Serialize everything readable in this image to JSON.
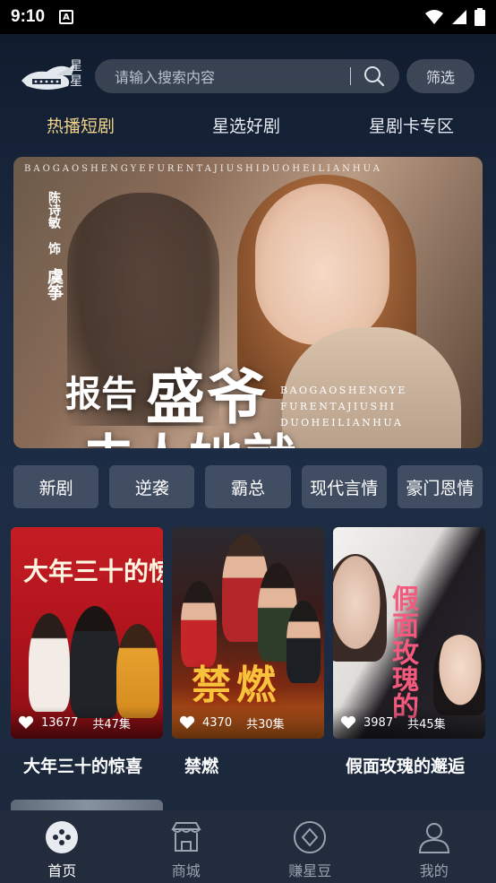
{
  "status_bar": {
    "time": "9:10",
    "notif_icon": "A"
  },
  "header": {
    "logo_text_line1": "星",
    "logo_text_line2": "星",
    "logo_sub": "THEATE",
    "search_placeholder": "请输入搜索内容",
    "filter_label": "筛选"
  },
  "tabs": [
    {
      "label": "热播短剧",
      "active": true
    },
    {
      "label": "星选好剧",
      "active": false
    },
    {
      "label": "星剧卡专区",
      "active": false
    }
  ],
  "banner": {
    "letters_top": "BAOGAOSHENGYEFURENTAJIUSHIDUOHEILIANHUA",
    "cast_name": "陈诗敏",
    "cast_as": "饰",
    "role_name": "虞筝",
    "title_small": "报告",
    "title_big": "盛爷",
    "title_bottom": "夫人她就",
    "subtitle_lines": [
      "BAOGAOSHENGYE",
      "FURENTAJIUSHI",
      "DUOHEILIANHUA"
    ]
  },
  "categories": [
    "新剧",
    "逆袭",
    "霸总",
    "现代言情",
    "豪门恩情"
  ],
  "dramas": [
    {
      "title": "大年三十的惊喜",
      "poster_text": "大年三十的惊喜",
      "likes": "13677",
      "episodes": "共47集"
    },
    {
      "title": "禁燃",
      "poster_text": "禁燃",
      "likes": "4370",
      "episodes": "共30集"
    },
    {
      "title": "假面玫瑰的邂逅",
      "poster_text": "假面玫瑰的",
      "likes": "3987",
      "episodes": "共45集"
    }
  ],
  "bottom_nav": [
    {
      "label": "首页",
      "icon": "home-icon",
      "active": true
    },
    {
      "label": "商城",
      "icon": "shop-icon",
      "active": false
    },
    {
      "label": "赚星豆",
      "icon": "diamond-icon",
      "active": false
    },
    {
      "label": "我的",
      "icon": "profile-icon",
      "active": false
    }
  ],
  "colors": {
    "active_tab": "#f3d28a",
    "background": "#1c2b44",
    "nav_bg": "#232c3c"
  }
}
